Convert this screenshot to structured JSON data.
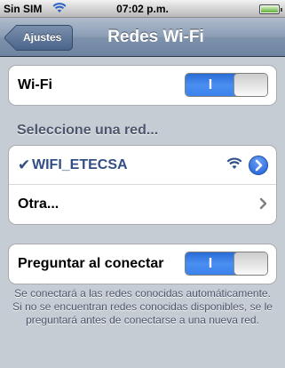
{
  "status_bar": {
    "carrier": "Sin SIM",
    "time": "07:02 p.m.",
    "wifi_icon": "wifi-icon",
    "battery_icon": "battery-icon"
  },
  "nav_bar": {
    "back_label": "Ajustes",
    "title": "Redes Wi-Fi"
  },
  "wifi_group": {
    "label": "Wi-Fi",
    "toggle_state": "I",
    "enabled": true
  },
  "networks_section": {
    "header": "Seleccione una red...",
    "networks": [
      {
        "name": "WIFI_ETECSA",
        "selected": true,
        "signal_icon": "wifi-signal-icon",
        "detail_icon": "disclosure-arrow-icon"
      }
    ],
    "other": {
      "label": "Otra...",
      "chevron_icon": "chevron-right-icon"
    }
  },
  "ask_group": {
    "label": "Preguntar al conectar",
    "toggle_state": "I",
    "enabled": true
  },
  "footer_note": "Se conectará a las redes conocidas automáticamente. Si no se encuentran redes conocidas disponibles, se le preguntará antes de conectarse a una nueva red.",
  "colors": {
    "background": "#c5ccd4",
    "nav_bar": "#6d83a1",
    "toggle_on": "#3b82ec",
    "selected_network": "#324f85",
    "section_text": "#4c566c"
  }
}
